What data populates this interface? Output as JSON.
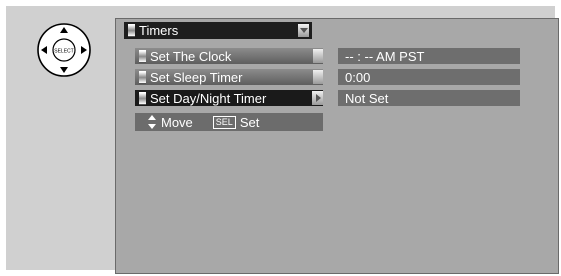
{
  "remote": {
    "button_label": "SELECT"
  },
  "menu": {
    "title": "Timers",
    "items": [
      {
        "label": "Set The Clock",
        "value": "-- : --  AM PST"
      },
      {
        "label": "Set Sleep Timer",
        "value": "0:00"
      },
      {
        "label": "Set Day/Night Timer",
        "value": "Not Set"
      }
    ]
  },
  "help": {
    "move_label": "Move",
    "sel_key": "SEL",
    "set_label": "Set"
  },
  "colors": {
    "selected": "#1a1a1a",
    "panel": "#a8a8a8",
    "value_bg": "#6e6e6e"
  }
}
